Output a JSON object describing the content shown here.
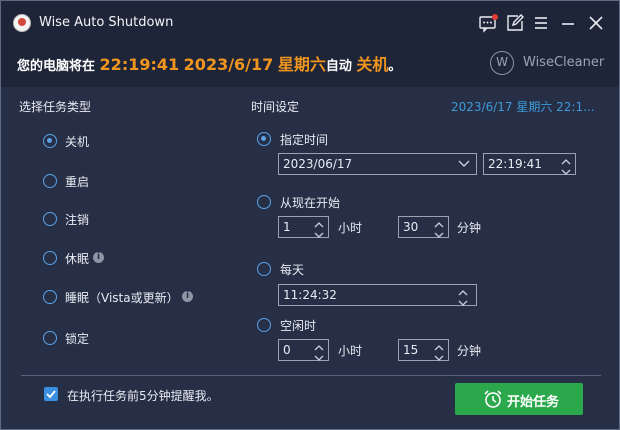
{
  "window": {
    "title": "Wise Auto Shutdown"
  },
  "titlebar": {
    "icons": [
      "message-icon",
      "edit-icon",
      "menu-icon",
      "minimize-icon",
      "close-icon"
    ]
  },
  "banner": {
    "prefix": "您的电脑将在",
    "time": "22:19:41",
    "date": "2023/6/17",
    "weekday": "星期六",
    "mid": "自动",
    "action": "关机",
    "suffix": "。",
    "brand_letter": "W",
    "brand_name": "WiseCleaner",
    "highlight_color": "#f0951d"
  },
  "task_type": {
    "title": "选择任务类型",
    "selected": "关机",
    "options": [
      {
        "label": "关机",
        "checked": true,
        "info": false
      },
      {
        "label": "重启",
        "checked": false,
        "info": false
      },
      {
        "label": "注销",
        "checked": false,
        "info": false
      },
      {
        "label": "休眠",
        "checked": false,
        "info": true
      },
      {
        "label": "睡眠（Vista或更新）",
        "checked": false,
        "info": true
      },
      {
        "label": "锁定",
        "checked": false,
        "info": false
      }
    ]
  },
  "time_settings": {
    "title": "时间设定",
    "current_datetime": "2023/6/17 星期六 22:1...",
    "specified": {
      "label": "指定时间",
      "checked": true,
      "date": "2023/06/17",
      "time": "22:19:41"
    },
    "from_now": {
      "label": "从现在开始",
      "checked": false,
      "hours": "1",
      "hours_unit": "小时",
      "minutes": "30",
      "minutes_unit": "分钟"
    },
    "daily": {
      "label": "每天",
      "checked": false,
      "time": "11:24:32"
    },
    "idle": {
      "label": "空闲时",
      "checked": false,
      "hours": "0",
      "hours_unit": "小时",
      "minutes": "15",
      "minutes_unit": "分钟"
    }
  },
  "footer": {
    "remind_label": "在执行任务前5分钟提醒我。",
    "remind_checked": true,
    "start_button": "开始任务",
    "start_color": "#2aa84b"
  }
}
